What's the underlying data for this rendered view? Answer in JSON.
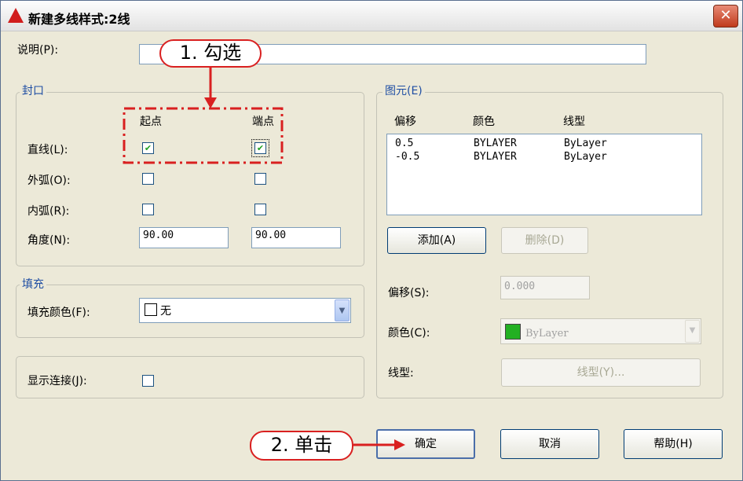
{
  "window": {
    "title": "新建多线样式:2线",
    "close": "✕"
  },
  "description": {
    "label": "说明(P):",
    "value": ""
  },
  "caps": {
    "title": "封口",
    "col_start": "起点",
    "col_end": "端点",
    "line_label": "直线(L):",
    "outer_arc_label": "外弧(O):",
    "inner_arc_label": "内弧(R):",
    "angle_label": "角度(N):",
    "line_start_checked": true,
    "line_end_checked": true,
    "outer_arc_start_checked": false,
    "outer_arc_end_checked": false,
    "inner_arc_start_checked": false,
    "inner_arc_end_checked": false,
    "angle_start": "90.00",
    "angle_end": "90.00"
  },
  "fill": {
    "title": "填充",
    "color_label": "填充颜色(F):",
    "color_value": "无"
  },
  "joints": {
    "label": "显示连接(J):",
    "checked": false
  },
  "elements": {
    "title": "图元(E)",
    "headers": [
      "偏移",
      "颜色",
      "线型"
    ],
    "rows": [
      {
        "offset": "0.5",
        "color": "BYLAYER",
        "linetype": "ByLayer"
      },
      {
        "offset": "-0.5",
        "color": "BYLAYER",
        "linetype": "ByLayer"
      }
    ],
    "add_label": "添加(A)",
    "delete_label": "删除(D)",
    "offset_label": "偏移(S):",
    "offset_value": "0.000",
    "color_label": "颜色(C):",
    "color_value": "ByLayer",
    "color_swatch": "#22b022",
    "linetype_label": "线型:",
    "linetype_button": "线型(Y)..."
  },
  "buttons": {
    "ok": "确定",
    "cancel": "取消",
    "help": "帮助(H)"
  },
  "annotations": {
    "step1": "1. 勾选",
    "step2": "2. 单击",
    "color": "#d92020"
  }
}
